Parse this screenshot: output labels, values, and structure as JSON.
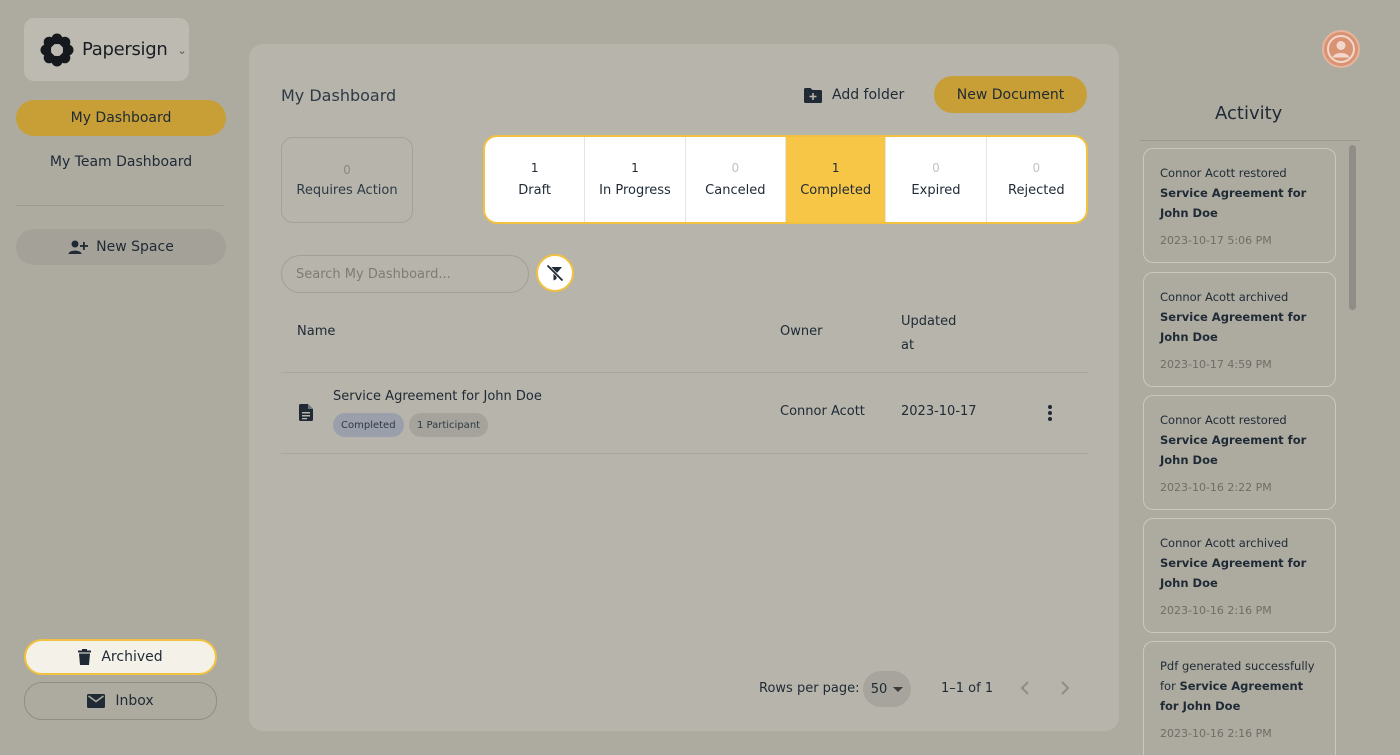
{
  "app": {
    "name": "Papersign"
  },
  "sidebar": {
    "my_dashboard": "My Dashboard",
    "team_dashboard": "My Team Dashboard",
    "new_space": "New Space",
    "archived": "Archived",
    "inbox": "Inbox"
  },
  "main": {
    "title": "My Dashboard",
    "add_folder": "Add folder",
    "new_document": "New Document",
    "requires_action": {
      "count": "0",
      "label": "Requires Action"
    },
    "statuses": [
      {
        "count": "1",
        "label": "Draft"
      },
      {
        "count": "1",
        "label": "In Progress"
      },
      {
        "count": "0",
        "label": "Canceled"
      },
      {
        "count": "1",
        "label": "Completed"
      },
      {
        "count": "0",
        "label": "Expired"
      },
      {
        "count": "0",
        "label": "Rejected"
      }
    ],
    "selected_status": "Completed",
    "search_placeholder": "Search My Dashboard...",
    "table": {
      "headers": {
        "name": "Name",
        "owner": "Owner",
        "updated": "Updated at"
      },
      "rows": [
        {
          "title": "Service Agreement for John Doe",
          "status": "Completed",
          "participants": "1 Participant",
          "owner": "Connor Acott",
          "updated": "2023-10-17"
        }
      ]
    },
    "pagination": {
      "rows_label": "Rows per page:",
      "rows_value": "50",
      "range": "1–1 of 1"
    }
  },
  "activity": {
    "title": "Activity",
    "items": [
      {
        "text": "Connor Acott restored",
        "doc": "Service Agreement for John Doe",
        "time": "2023-10-17 5:06 PM"
      },
      {
        "text": "Connor Acott archived",
        "doc": "Service Agreement for John Doe",
        "time": "2023-10-17 4:59 PM"
      },
      {
        "text": "Connor Acott restored",
        "doc": "Service Agreement for John Doe",
        "time": "2023-10-16 2:22 PM"
      },
      {
        "text": "Connor Acott archived",
        "doc": "Service Agreement for John Doe",
        "time": "2023-10-16 2:16 PM"
      },
      {
        "text": "Pdf generated successfully for",
        "doc": "Service Agreement for John Doe",
        "time": "2023-10-16 2:16 PM"
      }
    ]
  },
  "colors": {
    "accent": "#c79f36",
    "highlight": "#f7c646",
    "border_accent": "#f2c13f"
  },
  "icons": [
    "papersign-logo-icon",
    "chevron-down-icon",
    "add-user-icon",
    "trash-icon",
    "mail-icon",
    "folder-plus-icon",
    "filter-off-icon",
    "document-icon",
    "more-vertical-icon",
    "chevron-left-icon",
    "chevron-right-icon",
    "user-avatar-icon"
  ]
}
